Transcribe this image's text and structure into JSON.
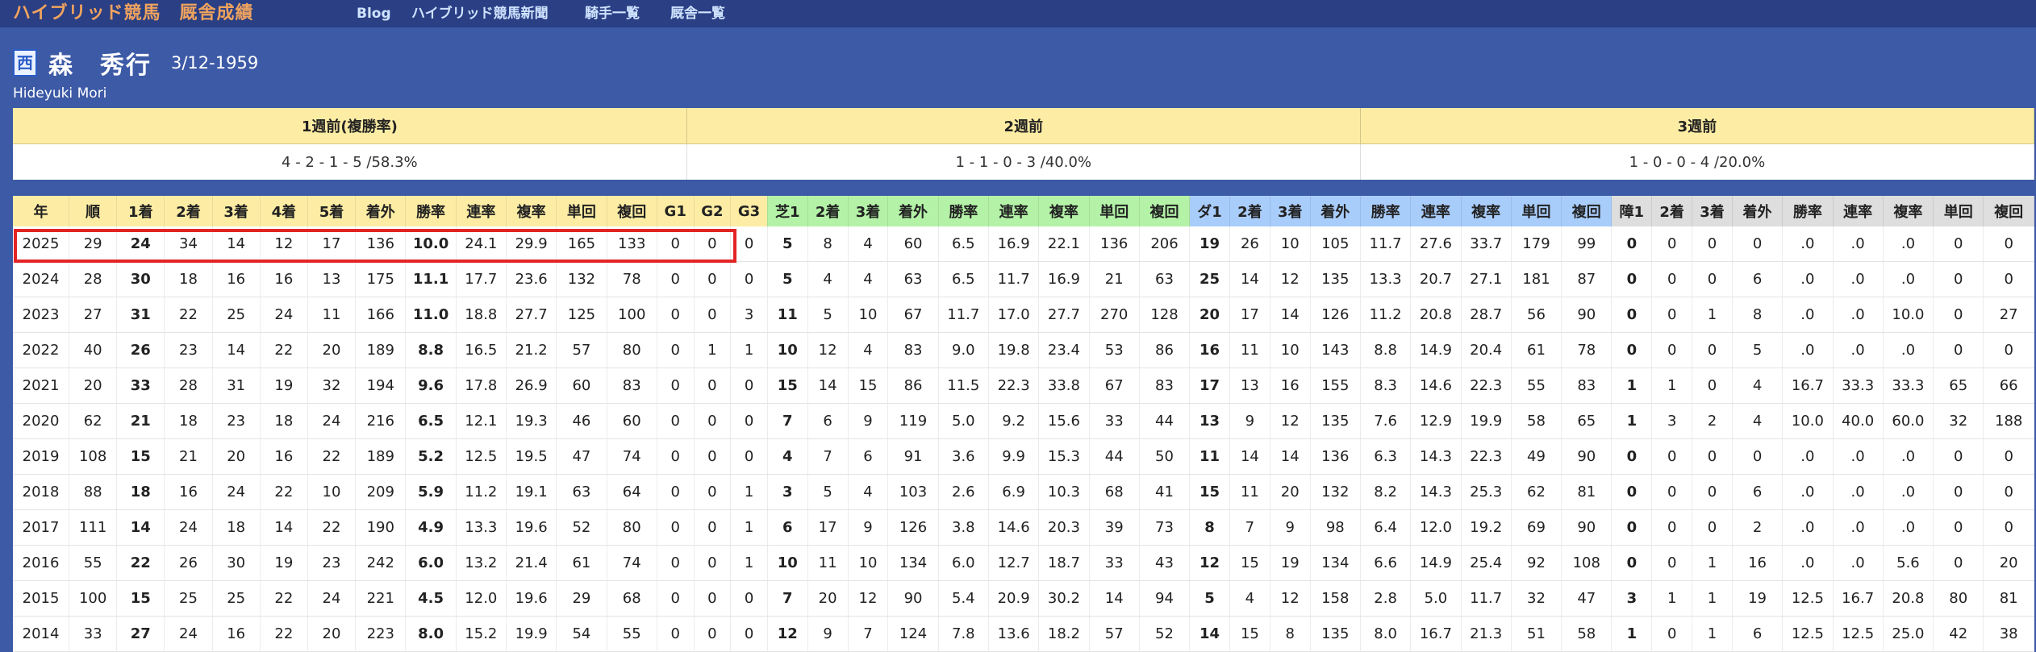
{
  "site": {
    "brand": "ハイブリッド競馬　厩舎成績",
    "nav": [
      "Blog",
      "ハイブリッド競馬新聞",
      "騎手一覧",
      "厩舎一覧"
    ]
  },
  "trainer": {
    "region_tag": "西",
    "name": "森　秀行",
    "birthdate": "3/12-1959",
    "romaji": "Hideyuki Mori"
  },
  "weekly_summary": {
    "headers": [
      "1週前(複勝率)",
      "2週前",
      "3週前"
    ],
    "values": [
      "4 - 2 - 1 - 5 /58.3%",
      "1 - 1 - 0 - 3 /40.0%",
      "1 - 0 - 0 - 4 /20.0%"
    ]
  },
  "stats_table": {
    "headers": [
      "年",
      "順",
      "1着",
      "2着",
      "3着",
      "4着",
      "5着",
      "着外",
      "勝率",
      "連率",
      "複率",
      "単回",
      "複回",
      "G1",
      "G2",
      "G3",
      "芝1",
      "2着",
      "3着",
      "着外",
      "勝率",
      "連率",
      "複率",
      "単回",
      "複回",
      "ダ1",
      "2着",
      "3着",
      "着外",
      "勝率",
      "連率",
      "複率",
      "単回",
      "複回",
      "障1",
      "2着",
      "3着",
      "着外",
      "勝率",
      "連率",
      "複率",
      "単回",
      "複回"
    ],
    "header_groups": {
      "basic": "#fdeda4",
      "turf": "#b3f2a7",
      "dirt": "#a9cdfb",
      "jump": "#dedede"
    },
    "highlight_color": "#e32424",
    "rows": [
      [
        "2025",
        "29",
        "24",
        "34",
        "14",
        "12",
        "17",
        "136",
        "10.0",
        "24.1",
        "29.9",
        "165",
        "133",
        "0",
        "0",
        "0",
        "5",
        "8",
        "4",
        "60",
        "6.5",
        "16.9",
        "22.1",
        "136",
        "206",
        "19",
        "26",
        "10",
        "105",
        "11.7",
        "27.6",
        "33.7",
        "179",
        "99",
        "0",
        "0",
        "0",
        "0",
        ".0",
        ".0",
        ".0",
        "0",
        "0"
      ],
      [
        "2024",
        "28",
        "30",
        "18",
        "16",
        "16",
        "13",
        "175",
        "11.1",
        "17.7",
        "23.6",
        "132",
        "78",
        "0",
        "0",
        "0",
        "5",
        "4",
        "4",
        "63",
        "6.5",
        "11.7",
        "16.9",
        "21",
        "63",
        "25",
        "14",
        "12",
        "135",
        "13.3",
        "20.7",
        "27.1",
        "181",
        "87",
        "0",
        "0",
        "0",
        "6",
        ".0",
        ".0",
        ".0",
        "0",
        "0"
      ],
      [
        "2023",
        "27",
        "31",
        "22",
        "25",
        "24",
        "11",
        "166",
        "11.0",
        "18.8",
        "27.7",
        "125",
        "100",
        "0",
        "0",
        "3",
        "11",
        "5",
        "10",
        "67",
        "11.7",
        "17.0",
        "27.7",
        "270",
        "128",
        "20",
        "17",
        "14",
        "126",
        "11.2",
        "20.8",
        "28.7",
        "56",
        "90",
        "0",
        "0",
        "1",
        "8",
        ".0",
        ".0",
        "10.0",
        "0",
        "27"
      ],
      [
        "2022",
        "40",
        "26",
        "23",
        "14",
        "22",
        "20",
        "189",
        "8.8",
        "16.5",
        "21.2",
        "57",
        "80",
        "0",
        "1",
        "1",
        "10",
        "12",
        "4",
        "83",
        "9.0",
        "19.8",
        "23.4",
        "53",
        "86",
        "16",
        "11",
        "10",
        "143",
        "8.8",
        "14.9",
        "20.4",
        "61",
        "78",
        "0",
        "0",
        "0",
        "5",
        ".0",
        ".0",
        ".0",
        "0",
        "0"
      ],
      [
        "2021",
        "20",
        "33",
        "28",
        "31",
        "19",
        "32",
        "194",
        "9.6",
        "17.8",
        "26.9",
        "60",
        "83",
        "0",
        "0",
        "0",
        "15",
        "14",
        "15",
        "86",
        "11.5",
        "22.3",
        "33.8",
        "67",
        "83",
        "17",
        "13",
        "16",
        "155",
        "8.3",
        "14.6",
        "22.3",
        "55",
        "83",
        "1",
        "1",
        "0",
        "4",
        "16.7",
        "33.3",
        "33.3",
        "65",
        "66"
      ],
      [
        "2020",
        "62",
        "21",
        "18",
        "23",
        "18",
        "24",
        "216",
        "6.5",
        "12.1",
        "19.3",
        "46",
        "60",
        "0",
        "0",
        "0",
        "7",
        "6",
        "9",
        "119",
        "5.0",
        "9.2",
        "15.6",
        "33",
        "44",
        "13",
        "9",
        "12",
        "135",
        "7.6",
        "12.9",
        "19.9",
        "58",
        "65",
        "1",
        "3",
        "2",
        "4",
        "10.0",
        "40.0",
        "60.0",
        "32",
        "188"
      ],
      [
        "2019",
        "108",
        "15",
        "21",
        "20",
        "16",
        "22",
        "189",
        "5.2",
        "12.5",
        "19.5",
        "47",
        "74",
        "0",
        "0",
        "0",
        "4",
        "7",
        "6",
        "91",
        "3.6",
        "9.9",
        "15.3",
        "44",
        "50",
        "11",
        "14",
        "14",
        "136",
        "6.3",
        "14.3",
        "22.3",
        "49",
        "90",
        "0",
        "0",
        "0",
        "0",
        ".0",
        ".0",
        ".0",
        "0",
        "0"
      ],
      [
        "2018",
        "88",
        "18",
        "16",
        "24",
        "22",
        "10",
        "209",
        "5.9",
        "11.2",
        "19.1",
        "63",
        "64",
        "0",
        "0",
        "1",
        "3",
        "5",
        "4",
        "103",
        "2.6",
        "6.9",
        "10.3",
        "68",
        "41",
        "15",
        "11",
        "20",
        "132",
        "8.2",
        "14.3",
        "25.3",
        "62",
        "81",
        "0",
        "0",
        "0",
        "6",
        ".0",
        ".0",
        ".0",
        "0",
        "0"
      ],
      [
        "2017",
        "111",
        "14",
        "24",
        "18",
        "14",
        "22",
        "190",
        "4.9",
        "13.3",
        "19.6",
        "52",
        "80",
        "0",
        "0",
        "1",
        "6",
        "17",
        "9",
        "126",
        "3.8",
        "14.6",
        "20.3",
        "39",
        "73",
        "8",
        "7",
        "9",
        "98",
        "6.4",
        "12.0",
        "19.2",
        "69",
        "90",
        "0",
        "0",
        "0",
        "2",
        ".0",
        ".0",
        ".0",
        "0",
        "0"
      ],
      [
        "2016",
        "55",
        "22",
        "26",
        "30",
        "19",
        "23",
        "242",
        "6.0",
        "13.2",
        "21.4",
        "61",
        "74",
        "0",
        "0",
        "1",
        "10",
        "11",
        "10",
        "134",
        "6.0",
        "12.7",
        "18.7",
        "33",
        "43",
        "12",
        "15",
        "19",
        "134",
        "6.6",
        "14.9",
        "25.4",
        "92",
        "108",
        "0",
        "0",
        "1",
        "16",
        ".0",
        ".0",
        "5.6",
        "0",
        "20"
      ],
      [
        "2015",
        "100",
        "15",
        "25",
        "25",
        "22",
        "24",
        "221",
        "4.5",
        "12.0",
        "19.6",
        "29",
        "68",
        "0",
        "0",
        "0",
        "7",
        "20",
        "12",
        "90",
        "5.4",
        "20.9",
        "30.2",
        "14",
        "94",
        "5",
        "4",
        "12",
        "158",
        "2.8",
        "5.0",
        "11.7",
        "32",
        "47",
        "3",
        "1",
        "1",
        "19",
        "12.5",
        "16.7",
        "20.8",
        "80",
        "81"
      ],
      [
        "2014",
        "33",
        "27",
        "24",
        "16",
        "22",
        "20",
        "223",
        "8.0",
        "15.2",
        "19.9",
        "54",
        "55",
        "0",
        "0",
        "0",
        "12",
        "9",
        "7",
        "124",
        "7.8",
        "13.6",
        "18.2",
        "57",
        "52",
        "14",
        "15",
        "8",
        "135",
        "8.0",
        "16.7",
        "21.3",
        "51",
        "58",
        "1",
        "0",
        "1",
        "6",
        "12.5",
        "12.5",
        "25.0",
        "42",
        "38"
      ]
    ]
  }
}
